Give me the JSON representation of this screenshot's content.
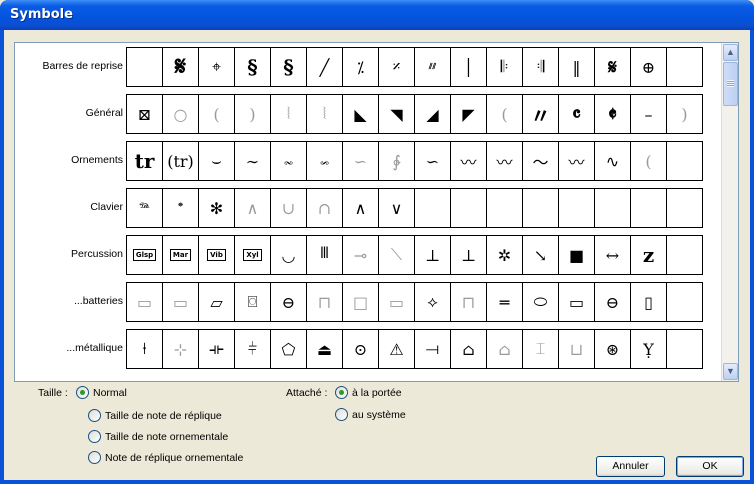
{
  "window": {
    "title": "Symbole"
  },
  "rows": [
    {
      "label": "Barres de reprise",
      "cells": [
        {
          "g": "",
          "t": "empty"
        },
        {
          "g": "𝄋",
          "t": "big"
        },
        {
          "g": "⌖",
          "t": "normal"
        },
        {
          "g": "§",
          "t": "heavy"
        },
        {
          "g": "§",
          "t": "heavy"
        },
        {
          "g": "╱",
          "t": "normal"
        },
        {
          "g": "⁒",
          "t": "normal"
        },
        {
          "g": "𝄎",
          "t": "normal"
        },
        {
          "g": "⫽⫽",
          "t": "small"
        },
        {
          "g": "│",
          "t": "normal"
        },
        {
          "g": "𝄆",
          "t": "normal"
        },
        {
          "g": "𝄇",
          "t": "normal"
        },
        {
          "g": "‖",
          "t": "normal"
        },
        {
          "g": "𝄋",
          "t": "heavy"
        },
        {
          "g": "⊕",
          "t": "normal"
        },
        {
          "g": "",
          "t": "empty"
        }
      ]
    },
    {
      "label": "Général",
      "cells": [
        {
          "g": "⊠",
          "t": "normal"
        },
        {
          "g": "○",
          "t": "faint"
        },
        {
          "g": "(",
          "t": "faint"
        },
        {
          "g": ")",
          "t": "faint"
        },
        {
          "g": "⦚",
          "t": "faint"
        },
        {
          "g": "⦚",
          "t": "faint"
        },
        {
          "g": "◣",
          "t": "normal"
        },
        {
          "g": "◥",
          "t": "normal"
        },
        {
          "g": "◢",
          "t": "normal"
        },
        {
          "g": "◤",
          "t": "normal"
        },
        {
          "g": "(",
          "t": "faint"
        },
        {
          "g": "〃",
          "t": "heavy"
        },
        {
          "g": "𝄴",
          "t": "heavy"
        },
        {
          "g": "𝄵",
          "t": "heavy"
        },
        {
          "g": "–",
          "t": "normal"
        },
        {
          "g": ")",
          "t": "faint"
        }
      ]
    },
    {
      "label": "Ornements",
      "cells": [
        {
          "g": "tr",
          "t": "heavy"
        },
        {
          "g": "(tr)",
          "t": "normal"
        },
        {
          "g": "⌣",
          "t": "normal"
        },
        {
          "g": "∼",
          "t": "normal"
        },
        {
          "g": "𝆗",
          "t": "normal"
        },
        {
          "g": "𝆘",
          "t": "normal"
        },
        {
          "g": "∽",
          "t": "faint"
        },
        {
          "g": "∲",
          "t": "faint"
        },
        {
          "g": "∽",
          "t": "normal"
        },
        {
          "g": "〰",
          "t": "normal"
        },
        {
          "g": "〰",
          "t": "normal"
        },
        {
          "g": "〜",
          "t": "normal"
        },
        {
          "g": "〰",
          "t": "normal"
        },
        {
          "g": "∿",
          "t": "normal"
        },
        {
          "g": "(",
          "t": "faint"
        },
        {
          "g": "",
          "t": "empty"
        }
      ]
    },
    {
      "label": "Clavier",
      "cells": [
        {
          "g": "𝆮",
          "t": "normal"
        },
        {
          "g": "𝆯",
          "t": "normal"
        },
        {
          "g": "✻",
          "t": "normal"
        },
        {
          "g": "∧",
          "t": "faint"
        },
        {
          "g": "∪",
          "t": "faint"
        },
        {
          "g": "∩",
          "t": "faint"
        },
        {
          "g": "∧",
          "t": "normal"
        },
        {
          "g": "∨",
          "t": "normal"
        },
        {
          "g": "",
          "t": "empty"
        },
        {
          "g": "",
          "t": "empty"
        },
        {
          "g": "",
          "t": "empty"
        },
        {
          "g": "",
          "t": "empty"
        },
        {
          "g": "",
          "t": "empty"
        },
        {
          "g": "",
          "t": "empty"
        },
        {
          "g": "",
          "t": "empty"
        },
        {
          "g": "",
          "t": "empty"
        }
      ]
    },
    {
      "label": "Percussion",
      "cells": [
        {
          "g": "Glsp",
          "t": "boxed"
        },
        {
          "g": "Mar",
          "t": "boxed"
        },
        {
          "g": "Vib",
          "t": "boxed"
        },
        {
          "g": "Xyl",
          "t": "boxed"
        },
        {
          "g": "◡",
          "t": "normal"
        },
        {
          "g": "𝍫",
          "t": "normal"
        },
        {
          "g": "⊸",
          "t": "faint"
        },
        {
          "g": "⟍",
          "t": "faint"
        },
        {
          "g": "⊥",
          "t": "normal"
        },
        {
          "g": "⊥",
          "t": "normal"
        },
        {
          "g": "✲",
          "t": "normal"
        },
        {
          "g": "↘",
          "t": "normal"
        },
        {
          "g": "■",
          "t": "normal"
        },
        {
          "g": "↔",
          "t": "normal"
        },
        {
          "g": "z",
          "t": "heavy"
        },
        {
          "g": "",
          "t": "empty"
        }
      ]
    },
    {
      "label": "...batteries",
      "cells": [
        {
          "g": "▭",
          "t": "faint"
        },
        {
          "g": "▭",
          "t": "faint"
        },
        {
          "g": "▱",
          "t": "normal"
        },
        {
          "g": "⌼",
          "t": "normal"
        },
        {
          "g": "⊖",
          "t": "normal"
        },
        {
          "g": "⊓",
          "t": "faint"
        },
        {
          "g": "□",
          "t": "faint"
        },
        {
          "g": "▭",
          "t": "faint"
        },
        {
          "g": "⟡",
          "t": "normal"
        },
        {
          "g": "⊓",
          "t": "faint"
        },
        {
          "g": "═",
          "t": "normal"
        },
        {
          "g": "⬭",
          "t": "normal"
        },
        {
          "g": "▭",
          "t": "normal"
        },
        {
          "g": "⊖",
          "t": "normal"
        },
        {
          "g": "▯",
          "t": "normal"
        },
        {
          "g": "",
          "t": "empty"
        }
      ]
    },
    {
      "label": "...métallique",
      "cells": [
        {
          "g": "⍿",
          "t": "normal"
        },
        {
          "g": "⊹",
          "t": "faint"
        },
        {
          "g": "⟛",
          "t": "normal"
        },
        {
          "g": "⫩",
          "t": "normal"
        },
        {
          "g": "⬠",
          "t": "normal"
        },
        {
          "g": "⏏",
          "t": "normal"
        },
        {
          "g": "⊙",
          "t": "normal"
        },
        {
          "g": "⚠",
          "t": "normal"
        },
        {
          "g": "⟞",
          "t": "normal"
        },
        {
          "g": "⌂",
          "t": "normal"
        },
        {
          "g": "⌂",
          "t": "faint"
        },
        {
          "g": "⌶",
          "t": "faint"
        },
        {
          "g": "⊔",
          "t": "faint"
        },
        {
          "g": "⊛",
          "t": "normal"
        },
        {
          "g": "Ỵ",
          "t": "normal"
        },
        {
          "g": "",
          "t": "empty"
        }
      ]
    }
  ],
  "size": {
    "label": "Taille :",
    "options": [
      "Normal",
      "Taille de note de réplique",
      "Taille de note ornementale",
      "Note de réplique ornementale"
    ],
    "selected": "Normal"
  },
  "attached": {
    "label": "Attaché :",
    "options": [
      "à la portée",
      "au système"
    ],
    "selected": "à la portée"
  },
  "buttons": {
    "cancel": "Annuler",
    "ok": "OK"
  },
  "icons": {
    "scroll_up": "up-arrow-icon",
    "scroll_down": "down-arrow-icon"
  }
}
